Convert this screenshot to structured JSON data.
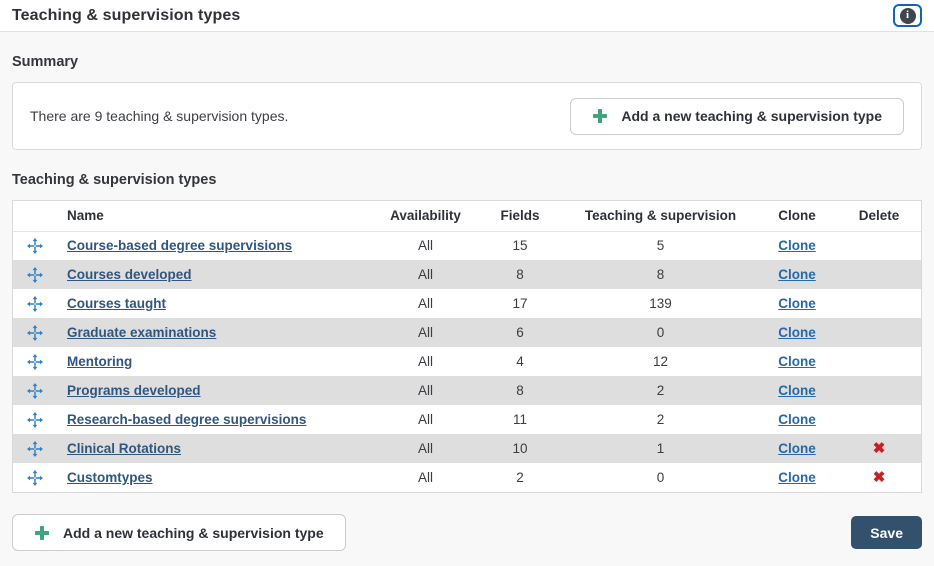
{
  "header": {
    "title": "Teaching & supervision types"
  },
  "summary": {
    "heading": "Summary",
    "text": "There are 9 teaching & supervision types.",
    "add_button_label": "Add a new teaching & supervision type"
  },
  "table": {
    "heading": "Teaching & supervision types",
    "columns": [
      "Name",
      "Availability",
      "Fields",
      "Teaching & supervision",
      "Clone",
      "Delete"
    ],
    "clone_label": "Clone",
    "delete_glyph": "✖",
    "rows": [
      {
        "name": "Course-based degree supervisions",
        "availability": "All",
        "fields": "15",
        "teaching_supervision": "5",
        "deletable": false
      },
      {
        "name": "Courses developed",
        "availability": "All",
        "fields": "8",
        "teaching_supervision": "8",
        "deletable": false
      },
      {
        "name": "Courses taught",
        "availability": "All",
        "fields": "17",
        "teaching_supervision": "139",
        "deletable": false
      },
      {
        "name": "Graduate examinations",
        "availability": "All",
        "fields": "6",
        "teaching_supervision": "0",
        "deletable": false
      },
      {
        "name": "Mentoring",
        "availability": "All",
        "fields": "4",
        "teaching_supervision": "12",
        "deletable": false
      },
      {
        "name": "Programs developed",
        "availability": "All",
        "fields": "8",
        "teaching_supervision": "2",
        "deletable": false
      },
      {
        "name": "Research-based degree supervisions",
        "availability": "All",
        "fields": "11",
        "teaching_supervision": "2",
        "deletable": false
      },
      {
        "name": "Clinical Rotations",
        "availability": "All",
        "fields": "10",
        "teaching_supervision": "1",
        "deletable": true
      },
      {
        "name": "Customtypes",
        "availability": "All",
        "fields": "2",
        "teaching_supervision": "0",
        "deletable": true
      }
    ]
  },
  "footer": {
    "add_button_label": "Add a new teaching & supervision type",
    "save_label": "Save"
  },
  "colors": {
    "accent_green": "#3fa37c",
    "handle_blue": "#2f81c6",
    "name_link_blue": "#31567e",
    "clone_link_blue": "#2569a8",
    "delete_red": "#c81f1f",
    "save_navy": "#32516d",
    "row_stripe_gray": "#dedede"
  },
  "icons": {
    "info": "i"
  }
}
